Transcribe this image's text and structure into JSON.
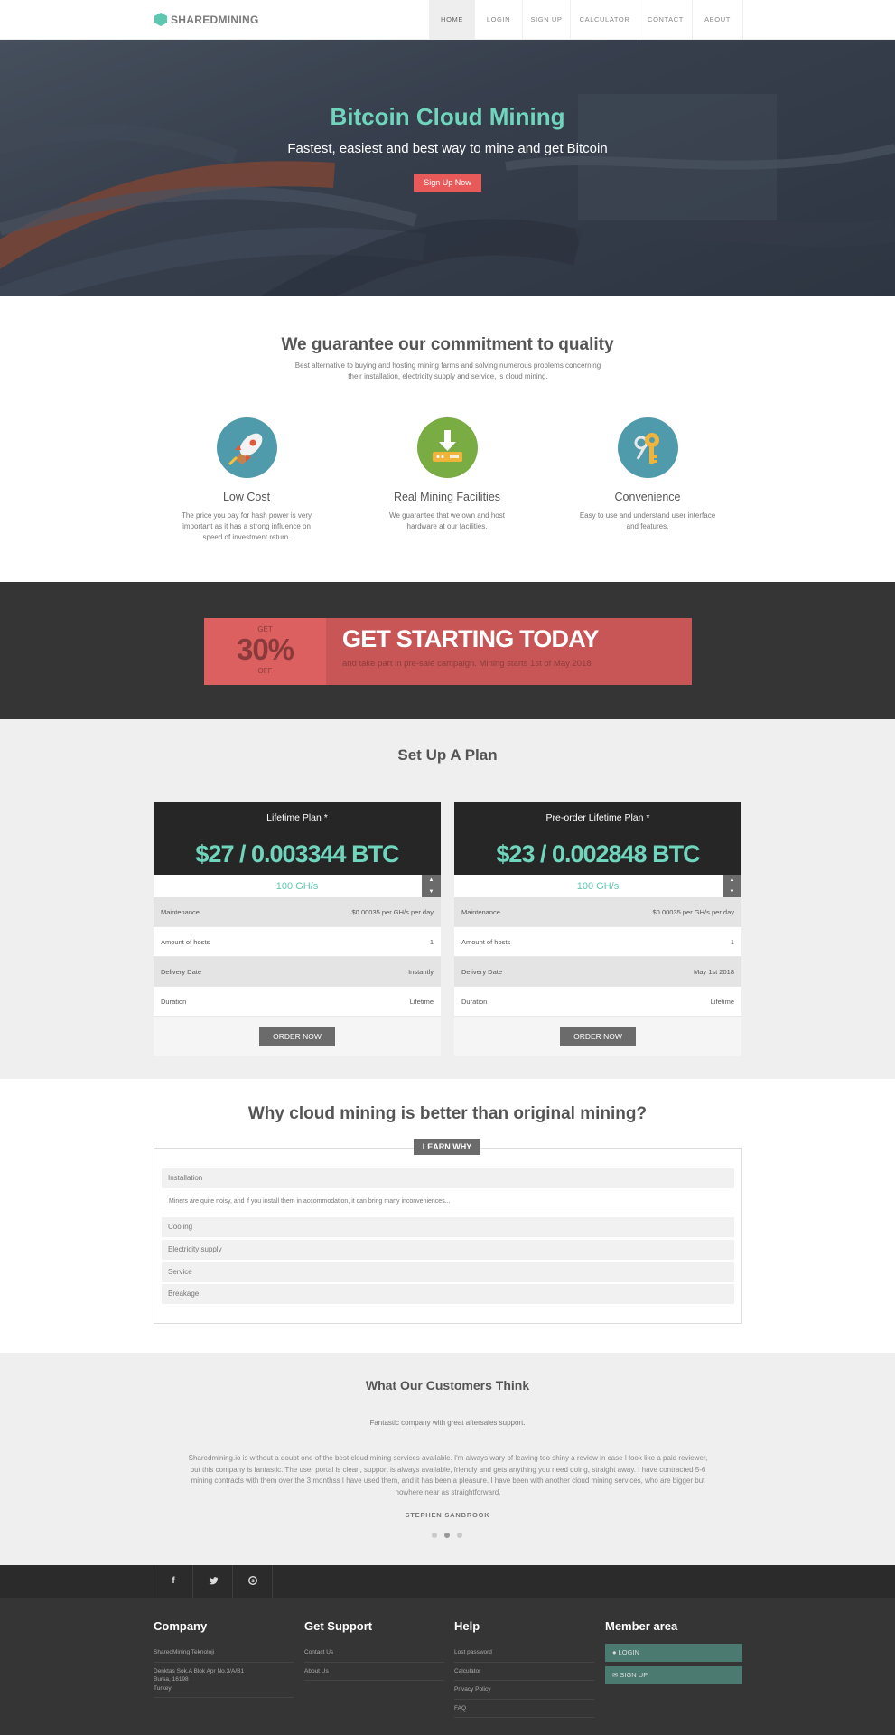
{
  "brand": {
    "name": "SHAREDMINING",
    "accent": "#5cc8b0",
    "red": "#e85a5a"
  },
  "nav": [
    {
      "label": "HOME",
      "active": true
    },
    {
      "label": "LOGIN"
    },
    {
      "label": "SIGN UP"
    },
    {
      "label": "CALCULATOR"
    },
    {
      "label": "CONTACT"
    },
    {
      "label": "ABOUT"
    }
  ],
  "hero": {
    "title": "Bitcoin Cloud Mining",
    "subtitle": "Fastest, easiest and best way to mine and get Bitcoin",
    "cta": "Sign Up Now"
  },
  "quality": {
    "title": "We guarantee our commitment to quality",
    "description": "Best alternative to buying and hosting mining farms and solving numerous problems concerning their installation, electricity supply and service, is cloud mining.",
    "features": [
      {
        "title": "Low Cost",
        "text": "The price you pay for hash power is very important as it has a strong influence on speed of investment return.",
        "icon": "rocket-icon",
        "color": "#4f9bab"
      },
      {
        "title": "Real Mining Facilities",
        "text": "We guarantee that we own and host hardware at our facilities.",
        "icon": "download-server-icon",
        "color": "#7aac44"
      },
      {
        "title": "Convenience",
        "text": "Easy to use and understand user interface and features.",
        "icon": "keys-icon",
        "color": "#4f9bab"
      }
    ]
  },
  "promo": {
    "get": "GET",
    "percent": "30%",
    "off": "OFF",
    "headline": "GET STARTING TODAY",
    "text": "and take part in pre-sale campaign. Mining starts 1st of May 2018"
  },
  "plans": {
    "title": "Set Up A Plan",
    "items": [
      {
        "name": "Lifetime Plan *",
        "price": "$27 / 0.003344 BTC",
        "hashrate": "100 GH/s",
        "rows": [
          {
            "label": "Maintenance",
            "value": "$0.00035 per GH/s per day"
          },
          {
            "label": "Amount of hosts",
            "value": "1"
          },
          {
            "label": "Delivery Date",
            "value": "Instantly"
          },
          {
            "label": "Duration",
            "value": "Lifetime"
          }
        ],
        "button": "ORDER NOW"
      },
      {
        "name": "Pre-order Lifetime Plan *",
        "price": "$23 / 0.002848 BTC",
        "hashrate": "100 GH/s",
        "rows": [
          {
            "label": "Maintenance",
            "value": "$0.00035 per GH/s per day"
          },
          {
            "label": "Amount of hosts",
            "value": "1"
          },
          {
            "label": "Delivery Date",
            "value": "May 1st 2018"
          },
          {
            "label": "Duration",
            "value": "Lifetime"
          }
        ],
        "button": "ORDER NOW"
      }
    ]
  },
  "why": {
    "title": "Why cloud mining is better than original mining?",
    "button": "LEARN WHY",
    "items": [
      {
        "title": "Installation",
        "body": "Miners are quite noisy, and if you install them in accommodation, it can bring many inconveniences..."
      },
      {
        "title": "Cooling"
      },
      {
        "title": "Electricity supply"
      },
      {
        "title": "Service"
      },
      {
        "title": "Breakage"
      }
    ]
  },
  "testimonials": {
    "title": "What Our Customers Think",
    "lead": "Fantastic company with great aftersales support.",
    "body": "Sharedmining.io is without a doubt one of the best cloud mining services available. I'm always wary of leaving too shiny a review in case I look like a paid reviewer, but this company is fantastic. The user portal is clean, support is always available, friendly and gets anything you need doing, straight away. I have contracted 5-6 mining contracts with them over the 3 monthss I have used them, and it has been a pleasure. I have been with another cloud mining services, who are bigger but nowhere near as straightforward.",
    "author": "STEPHEN SANBROOK"
  },
  "social": [
    "f",
    "t",
    "s"
  ],
  "footer": {
    "company": {
      "title": "Company",
      "name": "SharedMining Teknoloji",
      "address1": "Denktas Sok.A Blok Apr No.3/A/B1",
      "address2": "Bursa, 16198",
      "address3": "Turkey"
    },
    "support": {
      "title": "Get Support",
      "links": [
        "Contact Us",
        "About Us"
      ]
    },
    "help": {
      "title": "Help",
      "links": [
        "Lost password",
        "Calculator",
        "Privacy Policy",
        "FAQ"
      ]
    },
    "member": {
      "title": "Member area",
      "login": "LOGIN",
      "signup": "SIGN UP"
    }
  }
}
